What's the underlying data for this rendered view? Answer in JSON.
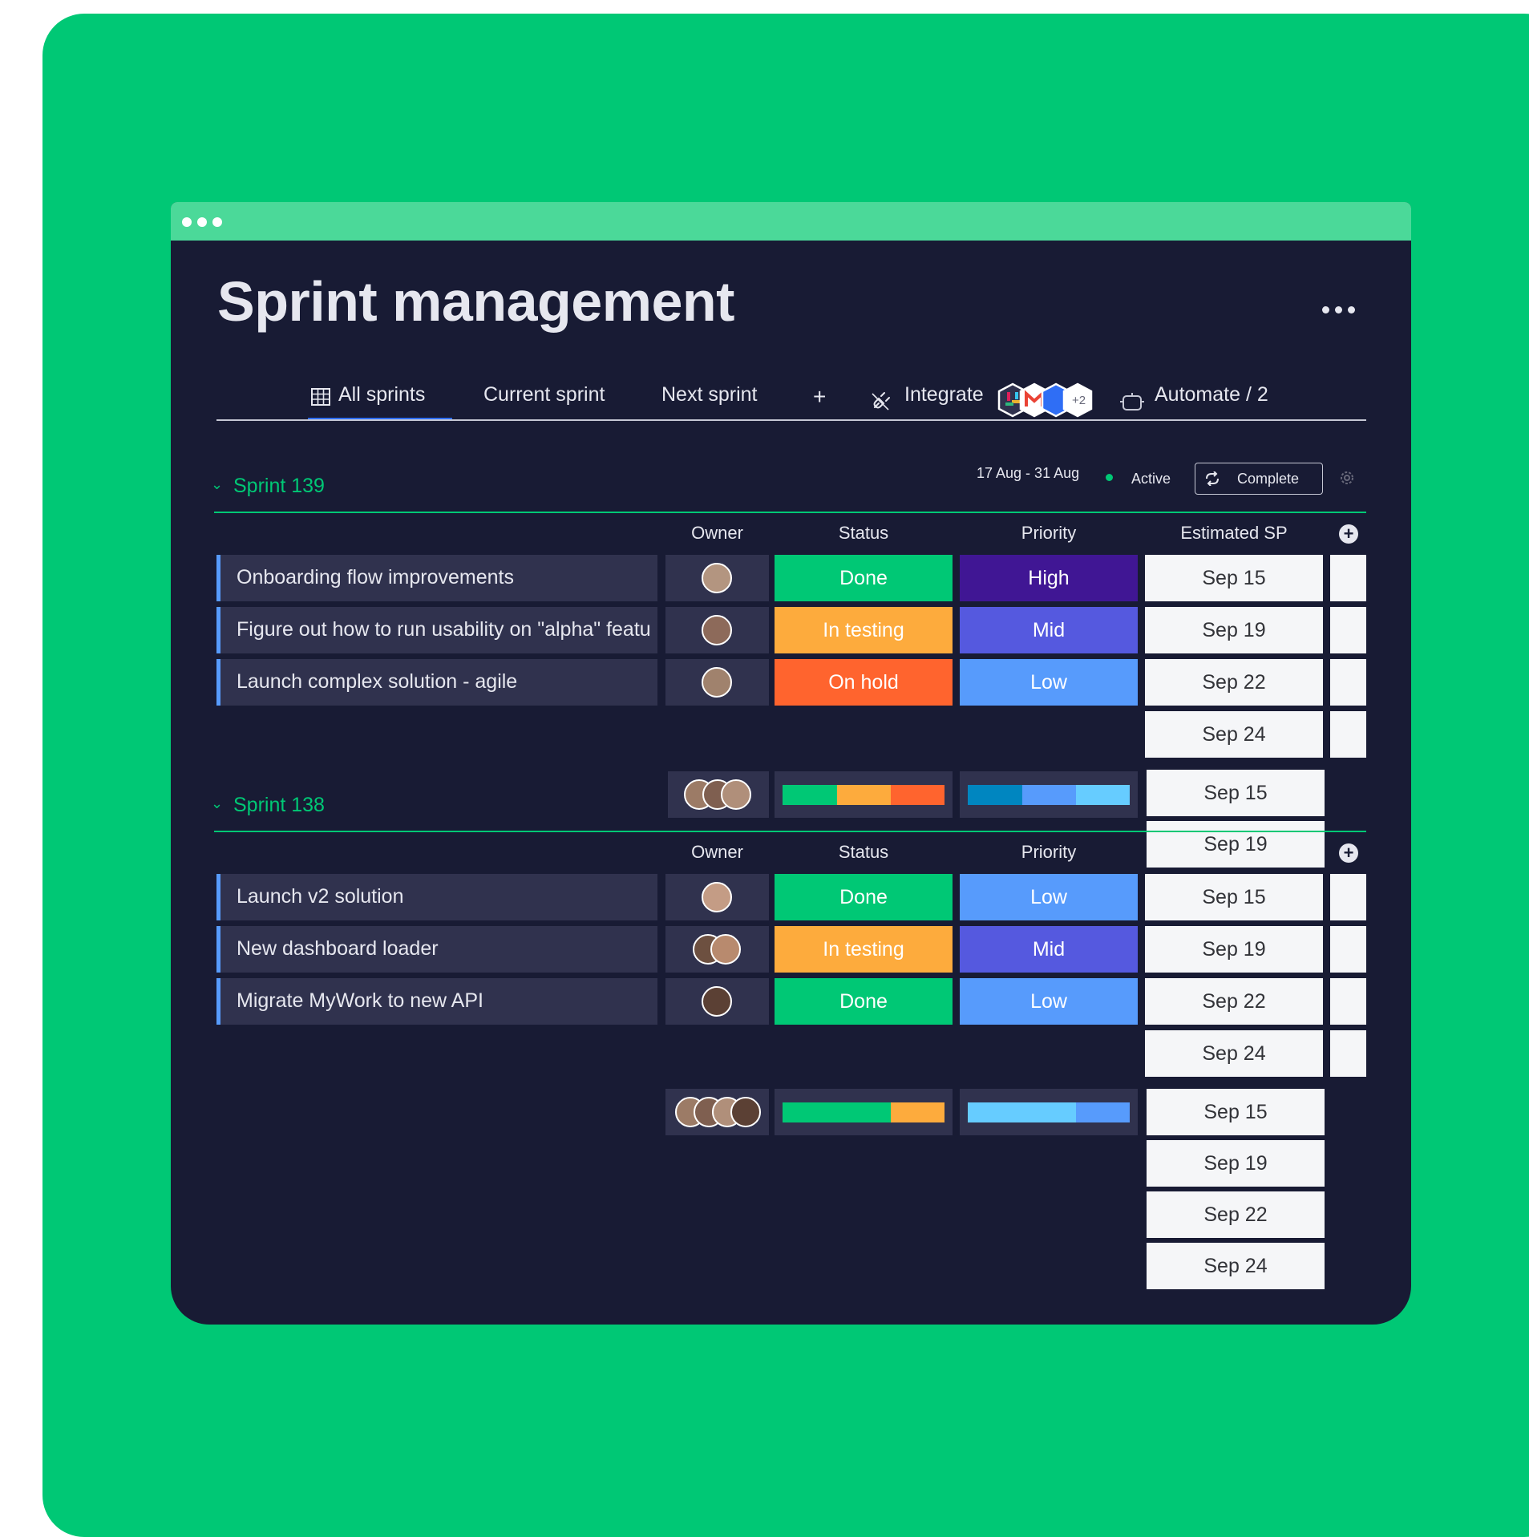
{
  "page": {
    "title": "Sprint management"
  },
  "tabs": {
    "all": "All sprints",
    "current": "Current sprint",
    "next": "Next sprint",
    "add": "+",
    "integrate": "Integrate",
    "integrate_count": "+2",
    "automate": "Automate / 2"
  },
  "sprint139": {
    "title": "Sprint 139",
    "dates": "17 Aug - 31 Aug",
    "state": "Active",
    "complete": "Complete",
    "columns": {
      "owner": "Owner",
      "status": "Status",
      "priority": "Priority",
      "estimated": "Estimated SP"
    },
    "rows": [
      {
        "name": "Onboarding flow improvements",
        "status": "Done",
        "priority": "High",
        "date": "Sep 15"
      },
      {
        "name": "Figure out how to run usability on \"alpha\" featu",
        "status": "In testing",
        "priority": "Mid",
        "date": "Sep 19"
      },
      {
        "name": "Launch complex solution - agile",
        "status": "On hold",
        "priority": "Low",
        "date": "Sep 22"
      }
    ],
    "extra_date": "Sep 24",
    "summary_dates": [
      "Sep 15",
      "Sep 19"
    ]
  },
  "sprint138": {
    "title": "Sprint 138",
    "columns": {
      "owner": "Owner",
      "status": "Status",
      "priority": "Priority"
    },
    "rows": [
      {
        "name": "Launch v2 solution",
        "status": "Done",
        "priority": "Low",
        "date": "Sep 15"
      },
      {
        "name": "New dashboard loader",
        "status": "In testing",
        "priority": "Mid",
        "date": "Sep 19"
      },
      {
        "name": "Migrate MyWork to new API",
        "status": "Done",
        "priority": "Low",
        "date": "Sep 22"
      }
    ],
    "extra_date": "Sep 24",
    "summary_dates": [
      "Sep 15",
      "Sep 19",
      "Sep 22",
      "Sep 24"
    ]
  },
  "colors": {
    "done": "#00c875",
    "testing": "#fdab3d",
    "onhold": "#ff642e",
    "high": "#401694",
    "mid": "#5559df",
    "low": "#579bfc",
    "brand_green": "#00c875",
    "window": "#181b34"
  }
}
